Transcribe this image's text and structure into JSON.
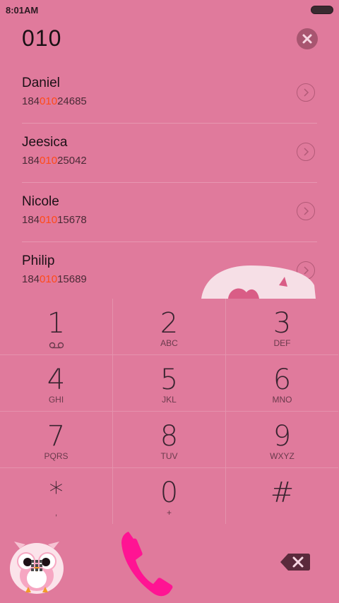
{
  "status": {
    "time": "8:01AM"
  },
  "dialer": {
    "input": "010"
  },
  "contacts": [
    {
      "name": "Daniel",
      "prefix": "184",
      "match": "010",
      "suffix": "24685"
    },
    {
      "name": "Jeesica",
      "prefix": "184",
      "match": "010",
      "suffix": "25042"
    },
    {
      "name": "Nicole",
      "prefix": "184",
      "match": "010",
      "suffix": "15678"
    },
    {
      "name": "Philip",
      "prefix": "184",
      "match": "010",
      "suffix": "15689"
    }
  ],
  "keypad": {
    "k1": {
      "digit": "1",
      "letters": ""
    },
    "k2": {
      "digit": "2",
      "letters": "ABC"
    },
    "k3": {
      "digit": "3",
      "letters": "DEF"
    },
    "k4": {
      "digit": "4",
      "letters": "GHI"
    },
    "k5": {
      "digit": "5",
      "letters": "JKL"
    },
    "k6": {
      "digit": "6",
      "letters": "MNO"
    },
    "k7": {
      "digit": "7",
      "letters": "PQRS"
    },
    "k8": {
      "digit": "8",
      "letters": "TUV"
    },
    "k9": {
      "digit": "9",
      "letters": "WXYZ"
    },
    "kstar": {
      "digit": "*",
      "letters": ","
    },
    "k0": {
      "digit": "0",
      "letters": "+"
    },
    "khash": {
      "digit": "#",
      "letters": ""
    }
  },
  "colors": {
    "background": "#e07a9c",
    "highlight": "#ff4a18",
    "call": "#ff1493"
  },
  "icons": {
    "clear": "clear-circle-icon",
    "arrow": "chevron-right-icon",
    "voicemail": "voicemail-icon",
    "call": "phone-icon",
    "backspace": "backspace-icon",
    "owl": "owl-keypad-icon"
  }
}
